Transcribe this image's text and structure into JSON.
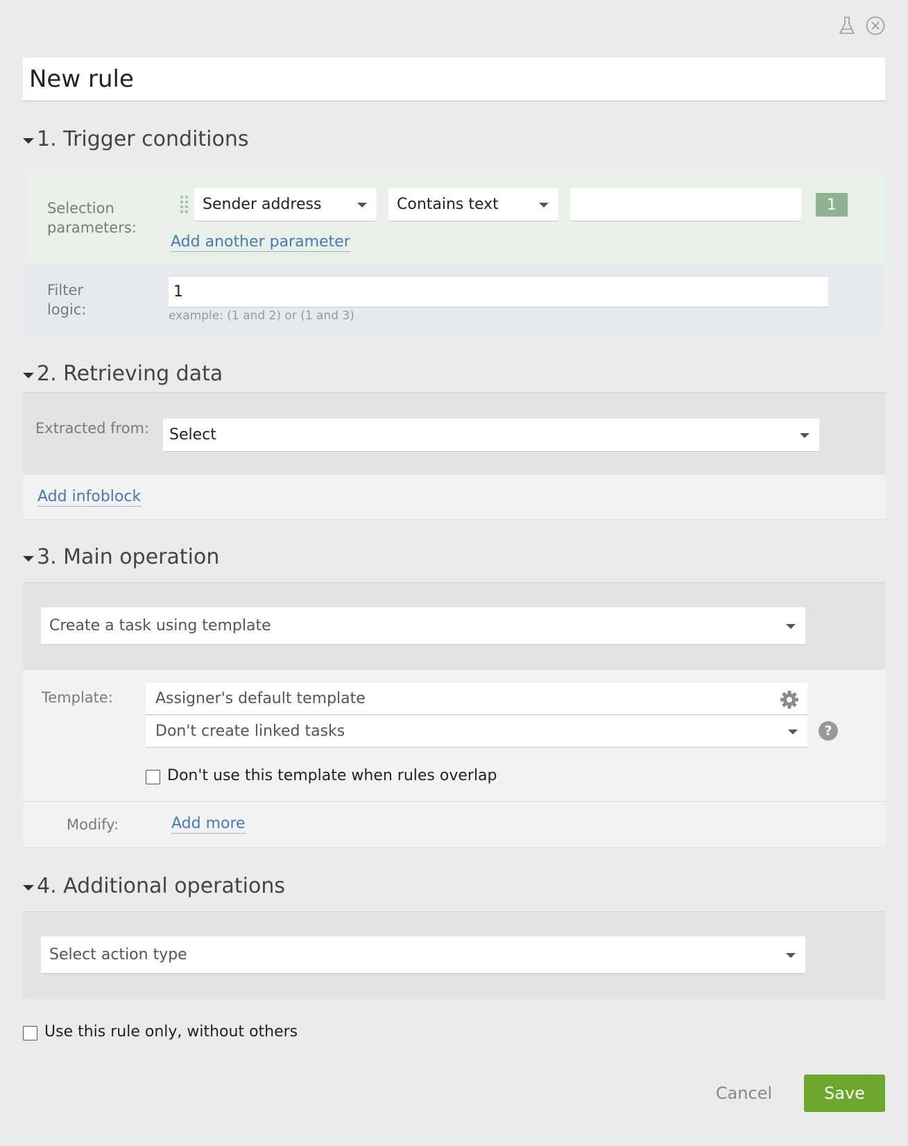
{
  "title_value": "New rule",
  "toolbar": {
    "lab_icon": "flask-icon",
    "close_icon": "close-icon"
  },
  "sections": {
    "s1": "1. Trigger conditions",
    "s2": "2. Retrieving data",
    "s3": "3. Main operation",
    "s4": "4. Additional operations"
  },
  "trigger": {
    "selection_label": "Selection\nparameters:",
    "field_select": "Sender address",
    "operator_select": "Contains text",
    "value_input": "",
    "param_badge": "1",
    "add_param_link": "Add another parameter",
    "filter_label": "Filter\nlogic:",
    "filter_value": "1",
    "filter_hint": "example: (1 and 2) or (1 and 3)"
  },
  "retrieving": {
    "extracted_label": "Extracted from:",
    "extracted_select": "Select",
    "add_infoblock_link": "Add infoblock"
  },
  "main_operation": {
    "operation_select": "Create a task using template",
    "template_label": "Template:",
    "template_value": "Assigner's default template",
    "linked_select": "Don't create linked tasks",
    "overlap_checkbox_label": "Don't use this template when rules overlap",
    "modify_label": "Modify:",
    "add_more_link": "Add more"
  },
  "additional": {
    "action_select": "Select action type"
  },
  "only_rule_checkbox_label": "Use this rule only, without others",
  "buttons": {
    "cancel": "Cancel",
    "save": "Save"
  },
  "colors": {
    "accent_green": "#6aa72c",
    "trigger_bg": "#e8f0ea",
    "filter_bg": "#e6e9ef",
    "badge_bg": "#8fb390",
    "link": "#4a78b8"
  }
}
